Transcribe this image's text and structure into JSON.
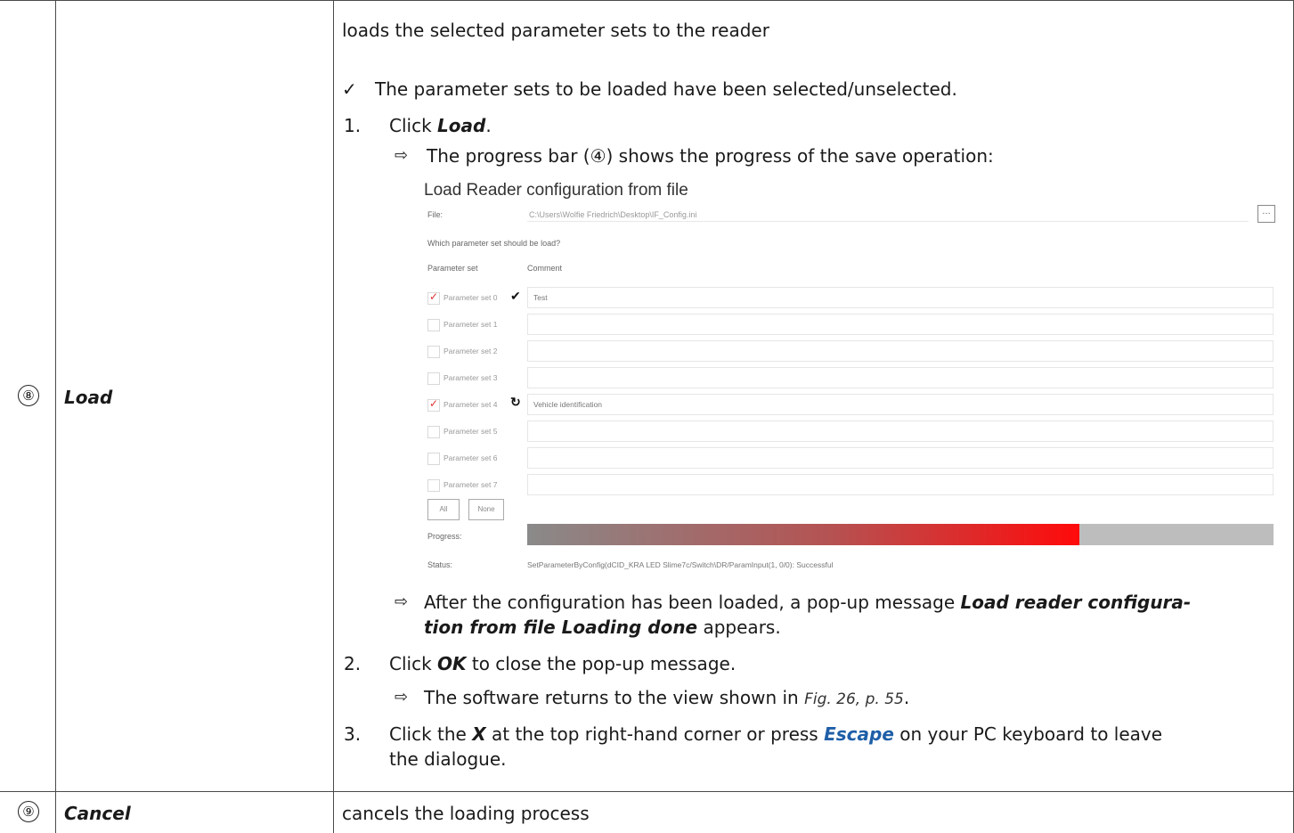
{
  "row8": {
    "number": "⑧",
    "name": "Load",
    "intro": "loads the selected parameter sets to the reader",
    "prereq_symbol": "✓",
    "prereq": "The parameter sets to be loaded have been selected/unselected.",
    "step1_num": "1.",
    "step1_pre": "Click ",
    "step1_bold": "Load",
    "step1_post": ".",
    "result_arrow": "⇨",
    "result1": "The progress bar (④) shows the progress of the save operation:",
    "result2_pre": "After the configuration has been loaded, a pop-up message ",
    "result2_bold1": "Load reader configura-",
    "result2_bold2": "tion from file Loading done",
    "result2_post": " appears.",
    "step2_num": "2.",
    "step2_pre": "Click ",
    "step2_bold": "OK",
    "step2_post": " to close the pop-up message.",
    "result3_pre": "The software returns to the view shown in ",
    "result3_ref": "Fig. 26, p. 55",
    "result3_post": ".",
    "step3_num": "3.",
    "step3_pre": "Click the ",
    "step3_bold": "X",
    "step3_mid": " at the top right-hand corner or press ",
    "step3_key": "Escape",
    "step3_post": " on your PC keyboard to leave",
    "step3_line2": "the dialogue."
  },
  "row9": {
    "number": "⑨",
    "name": "Cancel",
    "desc": "cancels the loading process"
  },
  "screenshot": {
    "title": "Load Reader configuration from file",
    "file_label": "File:",
    "file_path": "C:\\Users\\Wolfie Friedrich\\Desktop\\IF_Config.ini",
    "question": "Which parameter set should be load?",
    "col_set": "Parameter set",
    "col_comment": "Comment",
    "sets": [
      {
        "label": "Parameter set 0",
        "checked": true,
        "status": "✔",
        "comment": "Test"
      },
      {
        "label": "Parameter set 1",
        "checked": false,
        "status": "",
        "comment": ""
      },
      {
        "label": "Parameter set 2",
        "checked": false,
        "status": "",
        "comment": ""
      },
      {
        "label": "Parameter set 3",
        "checked": false,
        "status": "",
        "comment": ""
      },
      {
        "label": "Parameter set 4",
        "checked": true,
        "status": "↻",
        "comment": "Vehicle identification"
      },
      {
        "label": "Parameter set 5",
        "checked": false,
        "status": "",
        "comment": ""
      },
      {
        "label": "Parameter set 6",
        "checked": false,
        "status": "",
        "comment": ""
      },
      {
        "label": "Parameter set 7",
        "checked": false,
        "status": "",
        "comment": ""
      }
    ],
    "btn_all": "All",
    "btn_none": "None",
    "progress_label": "Progress:",
    "progress_value": 0.74,
    "status_label": "Status:",
    "status_text": "SetParameterByConfig(dCID_KRA LED Slime7c/Switch\\DR/ParamInput(1, 0/0): Successful",
    "browse_symbol": "…"
  }
}
